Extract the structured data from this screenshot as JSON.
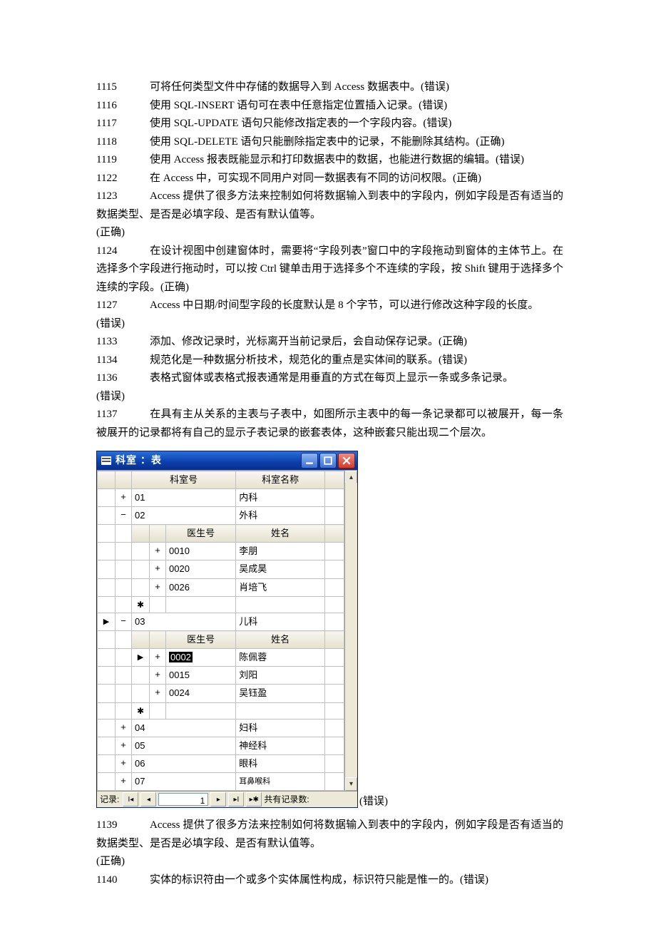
{
  "lines": {
    "l1115": {
      "num": "1115",
      "text": "可将任何类型文件中存储的数据导入到 Access 数据表中。(错误)"
    },
    "l1116": {
      "num": "1116",
      "text": "使用 SQL-INSERT 语句可在表中任意指定位置插入记录。(错误)"
    },
    "l1117": {
      "num": "1117",
      "text": "使用 SQL-UPDATE 语句只能修改指定表的一个字段内容。(错误)"
    },
    "l1118": {
      "num": "1118",
      "text": "使用 SQL-DELETE 语句只能删除指定表中的记录，不能删除其结构。(正确)"
    },
    "l1119": {
      "num": "1119",
      "text": "使用 Access 报表既能显示和打印数据表中的数据，也能进行数据的编辑。(错误)"
    },
    "l1122": {
      "num": "1122",
      "text": "在 Access 中，可实现不同用户对同一数据表有不同的访问权限。(正确)"
    },
    "l1123": {
      "num": "1123",
      "text": "Access 提供了很多方法来控制如何将数据输入到表中的字段内，例如字段是否有适当的数据类型、是否是必填字段、是否有默认值等。"
    },
    "l1123r": "(正确)",
    "l1124": {
      "num": "1124",
      "text": "在设计视图中创建窗体时，需要将“字段列表”窗口中的字段拖动到窗体的主体节上。在选择多个字段进行拖动时，可以按 Ctrl 键单击用于选择多个不连续的字段，按 Shift 键用于选择多个连续的字段。(正确)"
    },
    "l1127": {
      "num": "1127",
      "text": "Access 中日期/时间型字段的长度默认是 8 个字节，可以进行修改这种字段的长度。"
    },
    "l1127r": "(错误)",
    "l1133": {
      "num": "1133",
      "text": "添加、修改记录时，光标离开当前记录后，会自动保存记录。(正确)"
    },
    "l1134": {
      "num": "1134",
      "text": "规范化是一种数据分析技术，规范化的重点是实体间的联系。(错误)"
    },
    "l1136": {
      "num": "1136",
      "text": "表格式窗体或表格式报表通常是用垂直的方式在每页上显示一条或多条记录。"
    },
    "l1136r": "(错误)",
    "l1137": {
      "num": "1137",
      "text": "在具有主从关系的主表与子表中，如图所示主表中的每一条记录都可以被展开，每一条被展开的记录都将有自己的显示子表记录的嵌套表体，这种嵌套只能出现二个层次。"
    },
    "l1137r": "(错误)",
    "l1139": {
      "num": "1139",
      "text": "Access 提供了很多方法来控制如何将数据输入到表中的字段内，例如字段是否有适当的数据类型、是否是必填字段、是否有默认值等。"
    },
    "l1139r": "(正确)",
    "l1140": {
      "num": "1140",
      "text": "实体的标识符由一个或多个实体属性构成，标识符只能是惟一的。(错误)"
    }
  },
  "window": {
    "title": "科室 ：表",
    "headers": {
      "dept_no": "科室号",
      "dept_name": "科室名称",
      "doc_no": "医生号",
      "doc_name": "姓名"
    },
    "rows": {
      "r1": {
        "exp": "+",
        "no": "01",
        "name": "内科"
      },
      "r2": {
        "exp": "−",
        "no": "02",
        "name": "外科"
      },
      "r2c1": {
        "exp": "+",
        "no": "0010",
        "name": "李朋"
      },
      "r2c2": {
        "exp": "+",
        "no": "0020",
        "name": "吴成昊"
      },
      "r2c3": {
        "exp": "+",
        "no": "0026",
        "name": "肖培飞"
      },
      "r3": {
        "exp": "−",
        "no": "03",
        "name": "儿科"
      },
      "r3c1": {
        "exp": "+",
        "no": "0002",
        "name": "陈佩蓉"
      },
      "r3c2": {
        "exp": "+",
        "no": "0015",
        "name": "刘阳"
      },
      "r3c3": {
        "exp": "+",
        "no": "0024",
        "name": "吴钰盈"
      },
      "r4": {
        "exp": "+",
        "no": "04",
        "name": "妇科"
      },
      "r5": {
        "exp": "+",
        "no": "05",
        "name": "神经科"
      },
      "r6": {
        "exp": "+",
        "no": "06",
        "name": "眼科"
      },
      "r7": {
        "exp": "+",
        "no": "07",
        "name": "耳鼻喉科"
      }
    },
    "nav": {
      "label": "记录:",
      "value": "1",
      "total_label": "共有记录数:"
    },
    "star": "✱"
  }
}
